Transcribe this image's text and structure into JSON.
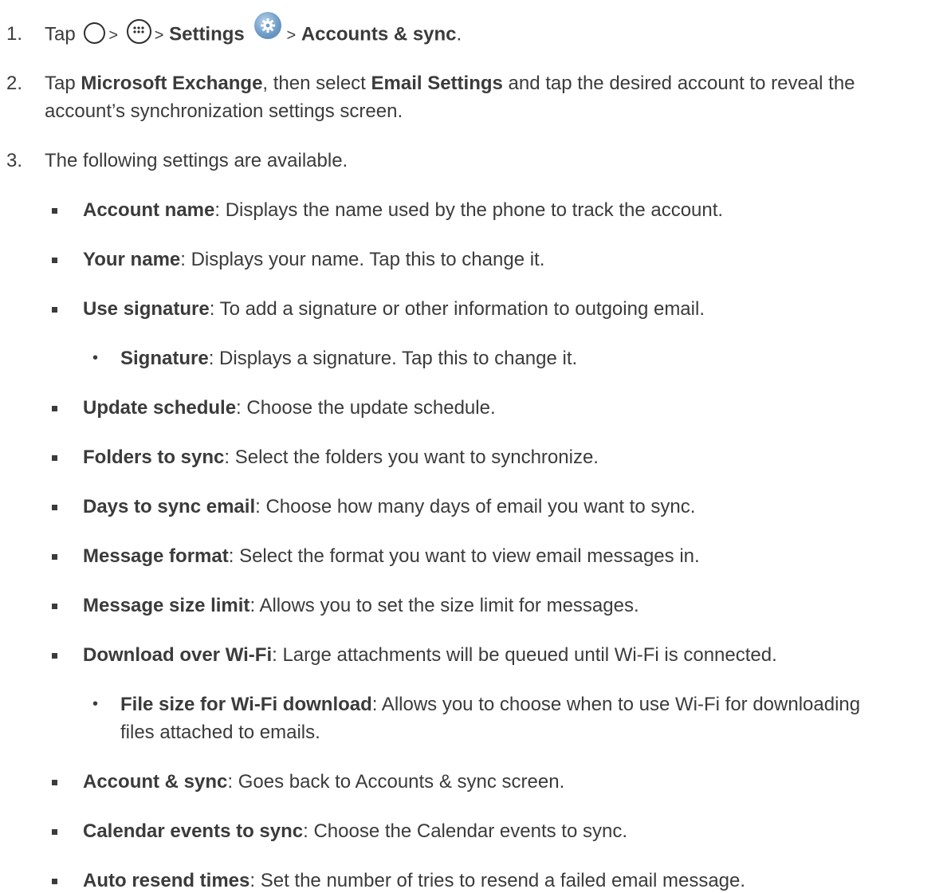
{
  "steps": [
    {
      "num": "1.",
      "parts": [
        "Tap",
        ">",
        ">",
        "Settings",
        ">",
        "Accounts & sync",
        "."
      ]
    },
    {
      "num": "2.",
      "line1": [
        "Tap ",
        "Microsoft Exchange",
        ", then select ",
        "Email Settings",
        " and tap the desired account to reveal the"
      ],
      "line2": "account’s synchronization settings screen."
    },
    {
      "num": "3.",
      "text": "The following settings are available."
    }
  ],
  "settings": [
    {
      "term": "Account name",
      "desc": ": Displays the name used by the phone to track the account."
    },
    {
      "term": "Your name",
      "desc": ": Displays your name. Tap this to change it."
    },
    {
      "term": "Use signature",
      "desc": ": To add a signature or other information to outgoing email."
    },
    {
      "term": "Signature",
      "desc": ": Displays a signature. Tap this to change it."
    },
    {
      "term": "Update schedule",
      "desc": ": Choose the update schedule."
    },
    {
      "term": "Folders to sync",
      "desc": ": Select the folders you want to synchronize."
    },
    {
      "term": "Days to sync email",
      "desc": ": Choose how many days of email you want to sync."
    },
    {
      "term": "Message format",
      "desc": ": Select the format you want to view email messages in."
    },
    {
      "term": "Message size limit",
      "desc": ": Allows you to set the size limit for messages."
    },
    {
      "term": "Download over Wi-Fi",
      "desc": ": Large attachments will be queued until Wi-Fi is connected."
    },
    {
      "term": "File size for Wi-Fi download",
      "desc": ": Allows you to choose when to use Wi-Fi for downloading",
      "desc2": "files attached to emails."
    },
    {
      "term": "Account & sync",
      "desc": ": Goes back to Accounts & sync screen."
    },
    {
      "term": "Calendar events to sync",
      "desc": ": Choose the Calendar events to sync."
    },
    {
      "term": "Auto resend times",
      "desc": ": Set the number of tries to resend a failed email message."
    }
  ],
  "bullets": {
    "square": "▪",
    "dot": "•"
  },
  "icons": [
    "home-icon",
    "apps-icon",
    "settings-gear-icon"
  ]
}
